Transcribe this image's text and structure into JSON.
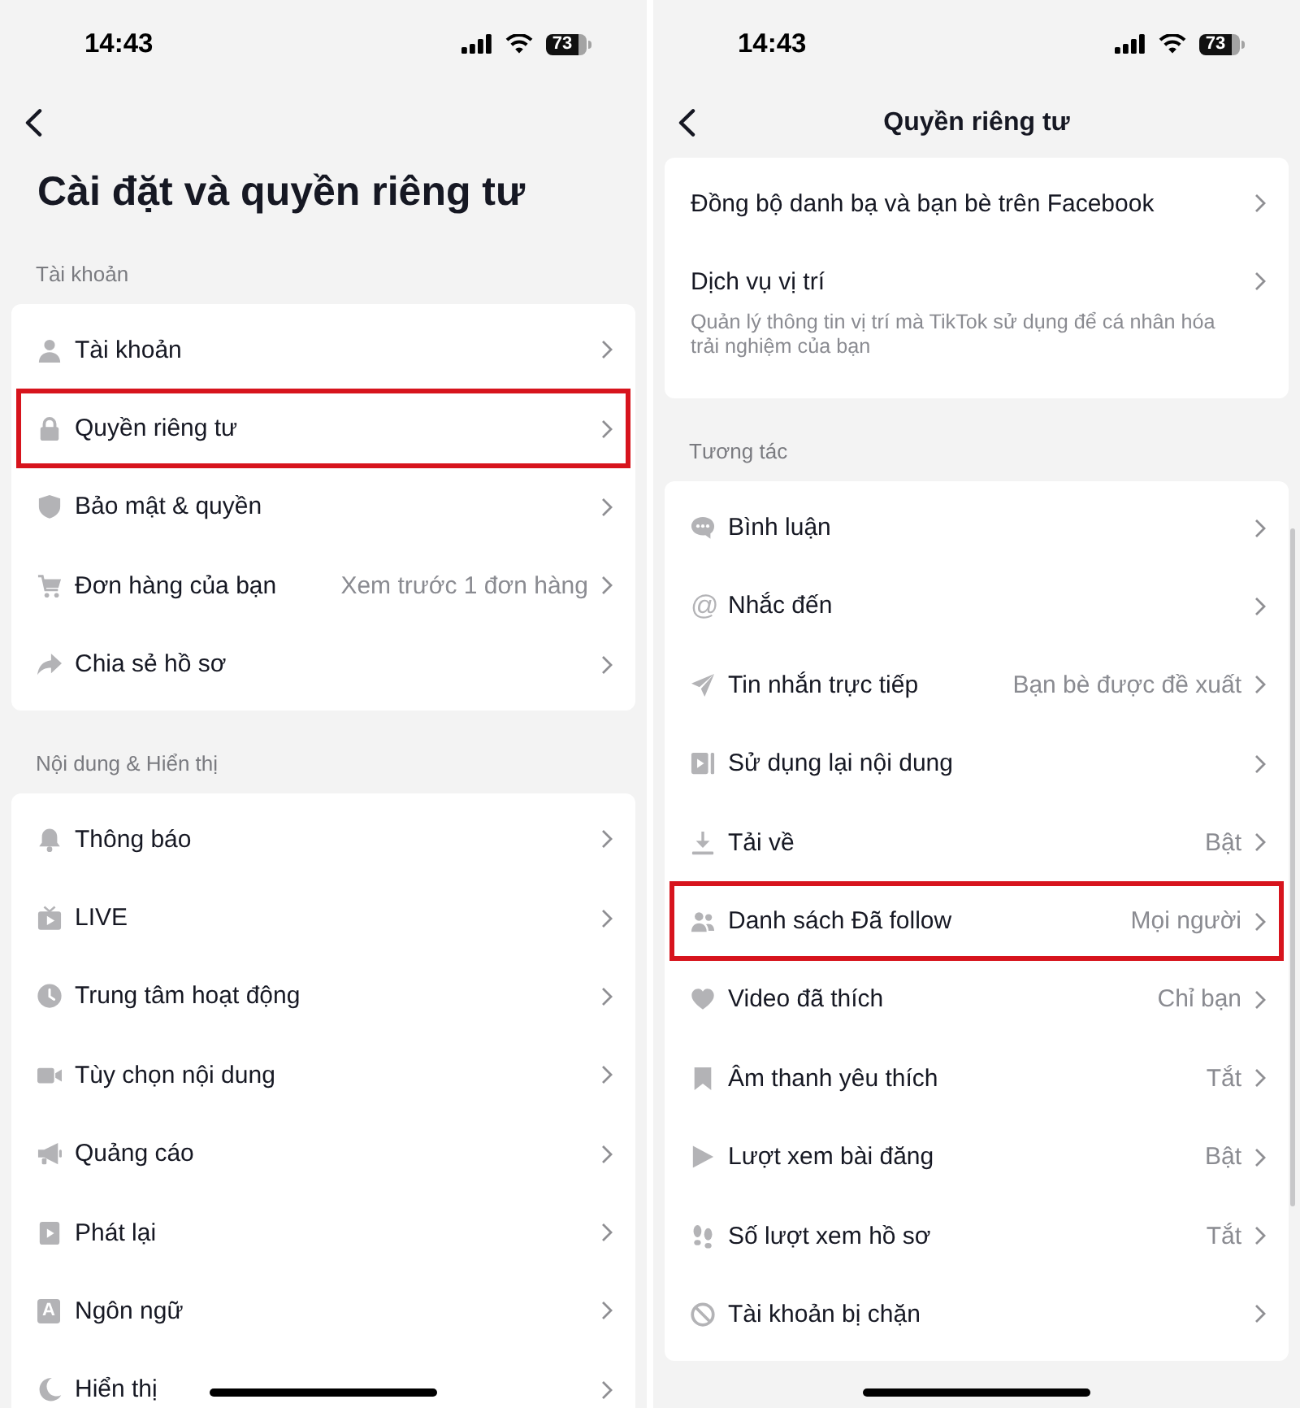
{
  "screens": [
    {
      "status_bar": {
        "time": "14:43",
        "battery": "73"
      },
      "header": {
        "kind": "large",
        "title": "Cài đặt và quyền riêng tư"
      },
      "sections": [
        {
          "label": "Tài khoản",
          "items": [
            {
              "label": "Tài khoản",
              "highlighted": false
            },
            {
              "label": "Quyền riêng tư",
              "highlighted": true
            },
            {
              "label": "Bảo mật & quyền",
              "highlighted": false
            },
            {
              "label": "Đơn hàng của bạn",
              "value": "Xem trước 1 đơn hàng",
              "highlighted": false
            },
            {
              "label": "Chia sẻ hồ sơ",
              "highlighted": false
            }
          ]
        },
        {
          "label": "Nội dung & Hiển thị",
          "items": [
            {
              "label": "Thông báo",
              "highlighted": false
            },
            {
              "label": "LIVE",
              "highlighted": false
            },
            {
              "label": "Trung tâm hoạt động",
              "highlighted": false
            },
            {
              "label": "Tùy chọn nội dung",
              "highlighted": false
            },
            {
              "label": "Quảng cáo",
              "highlighted": false
            },
            {
              "label": "Phát lại",
              "highlighted": false
            },
            {
              "label": "Ngôn ngữ",
              "icon_glyph": "A",
              "highlighted": false
            },
            {
              "label": "Hiển thị",
              "highlighted": false
            }
          ]
        }
      ]
    },
    {
      "status_bar": {
        "time": "14:43",
        "battery": "73"
      },
      "header": {
        "kind": "centered",
        "title": "Quyền riêng tư"
      },
      "sections": [
        {
          "items": [
            {
              "label": "Đồng bộ danh bạ và bạn bè trên Facebook",
              "highlighted": false
            },
            {
              "label": "Dịch vụ vị trí",
              "description": "Quản lý thông tin vị trí mà TikTok sử dụng để cá nhân hóa trải nghiệm của bạn",
              "highlighted": false
            }
          ]
        },
        {
          "label": "Tương tác",
          "items": [
            {
              "label": "Bình luận",
              "highlighted": false
            },
            {
              "label": "Nhắc đến",
              "icon_glyph": "@",
              "highlighted": false
            },
            {
              "label": "Tin nhắn trực tiếp",
              "value": "Bạn bè được đề xuất",
              "highlighted": false
            },
            {
              "label": "Sử dụng lại nội dung",
              "highlighted": false
            },
            {
              "label": "Tải về",
              "value": "Bật",
              "highlighted": false
            },
            {
              "label": "Danh sách Đã follow",
              "value": "Mọi người",
              "highlighted": true
            },
            {
              "label": "Video đã thích",
              "value": "Chỉ bạn",
              "highlighted": false
            },
            {
              "label": "Âm thanh yêu thích",
              "value": "Tắt",
              "highlighted": false
            },
            {
              "label": "Lượt xem bài đăng",
              "value": "Bật",
              "highlighted": false
            },
            {
              "label": "Số lượt xem hồ sơ",
              "value": "Tắt",
              "highlighted": false
            },
            {
              "label": "Tài khoản bị chặn",
              "highlighted": false
            }
          ]
        }
      ],
      "scroll_indicator": true
    }
  ]
}
